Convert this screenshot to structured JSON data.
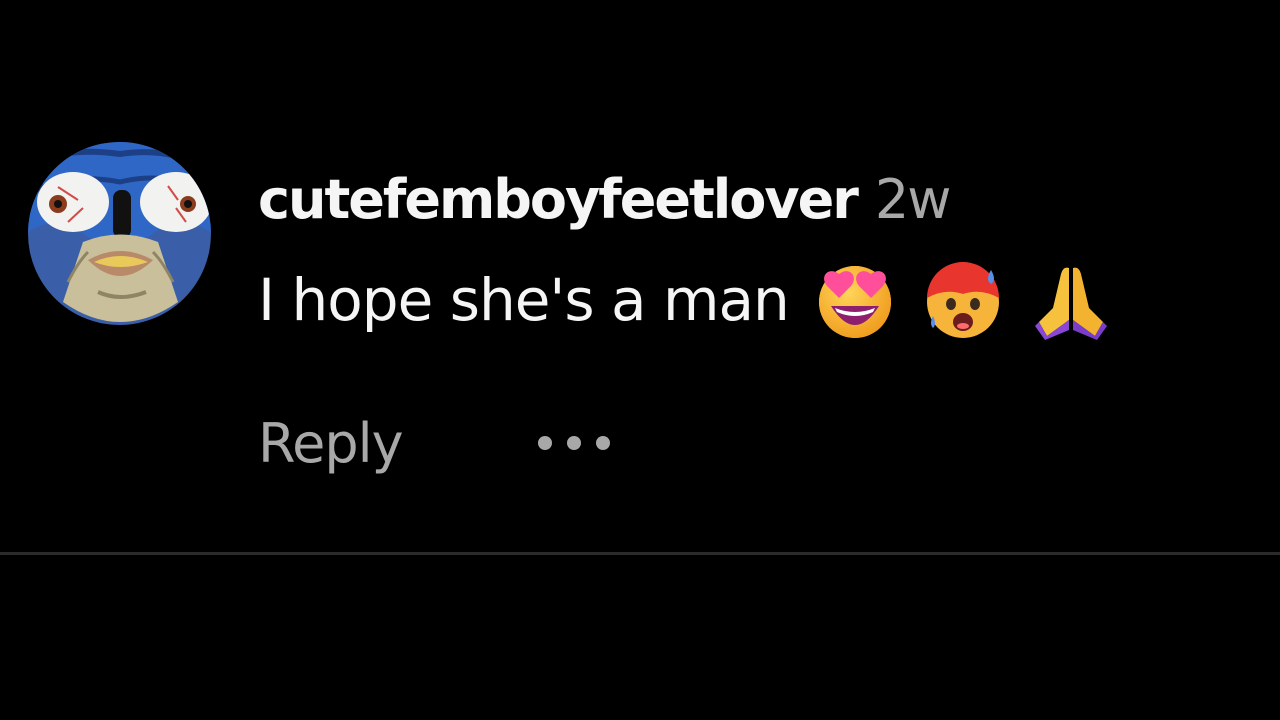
{
  "comment": {
    "username": "cutefemboyfeetlover",
    "timestamp": "2w",
    "text": "I hope she's a man",
    "emojis": [
      "smiling-face-with-heart-eyes",
      "hot-face-sweating",
      "folded-hands"
    ],
    "actions": {
      "reply_label": "Reply",
      "more_icon": "more-options-icon"
    }
  },
  "colors": {
    "background": "#000000",
    "primary_text": "#f5f5f5",
    "secondary_text": "#a8a8a8",
    "divider": "#2b2b2b"
  }
}
